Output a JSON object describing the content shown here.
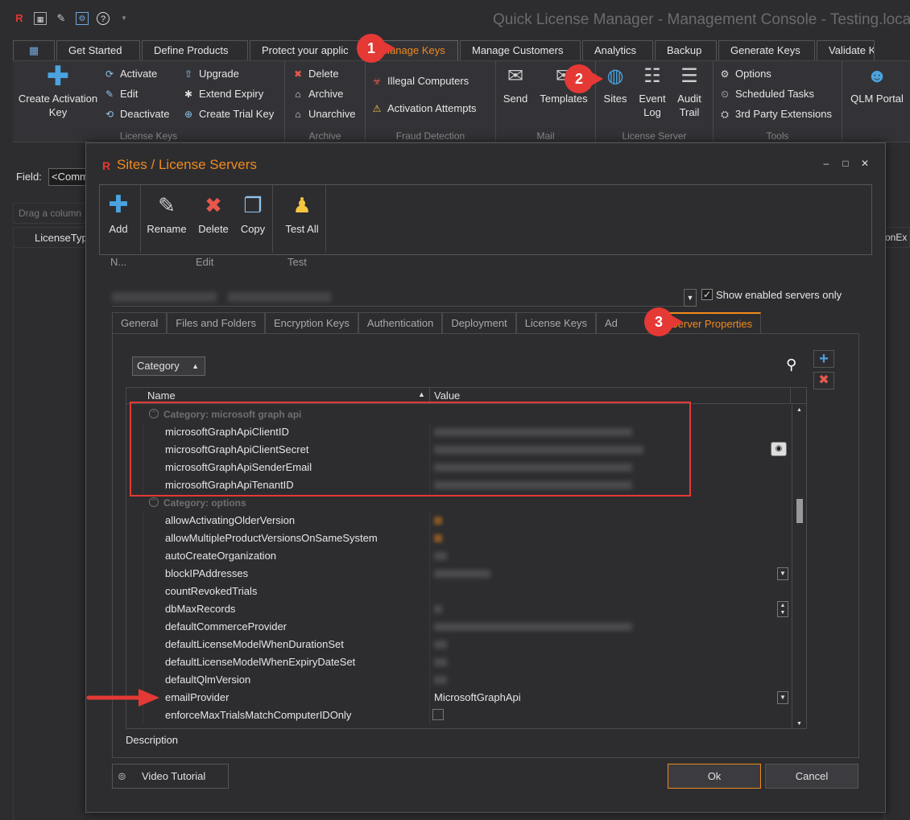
{
  "window": {
    "title": "Quick License Manager - Management Console - Testing.localh"
  },
  "quick_access": [
    "app-icon",
    "grid-icon",
    "wand-icon",
    "settings-icon",
    "help-icon",
    "dropdown-icon"
  ],
  "ribbon_tabs": [
    {
      "label": "Get Started"
    },
    {
      "label": "Define Products"
    },
    {
      "label": "Protect your applic"
    },
    {
      "label": "Manage Keys"
    },
    {
      "label": "Manage Customers"
    },
    {
      "label": "Analytics"
    },
    {
      "label": "Backup"
    },
    {
      "label": "Generate Keys"
    },
    {
      "label": "Validate K"
    }
  ],
  "ribbon": {
    "create_key": "Create Activation Key",
    "activate": "Activate",
    "edit": "Edit",
    "deactivate": "Deactivate",
    "upgrade": "Upgrade",
    "extend_expiry": "Extend Expiry",
    "create_trial_key": "Create Trial Key",
    "license_keys_group": "License Keys",
    "delete": "Delete",
    "archive": "Archive",
    "unarchive": "Unarchive",
    "archive_group": "Archive",
    "illegal_computers": "Illegal Computers",
    "activation_attempts": "Activation Attempts",
    "fraud_group": "Fraud Detection",
    "send": "Send",
    "templates": "Templates",
    "mail_group": "Mail",
    "sites": "Sites",
    "event_log": "Event Log",
    "audit_trail": "Audit Trail",
    "license_server_group": "License Server",
    "options": "Options",
    "scheduled_tasks": "Scheduled Tasks",
    "third_party": "3rd Party Extensions",
    "tools_group": "Tools",
    "qlm_portal": "QLM Portal"
  },
  "background": {
    "field_label": "Field:",
    "field_value": "<Comm",
    "drag_hint": "Drag a column",
    "license_type_col": "LicenseTyp",
    "right_col": "onEx"
  },
  "dialog": {
    "title": "Sites / License Servers",
    "toolbar": {
      "add": "Add",
      "rename": "Rename",
      "delete": "Delete",
      "copy": "Copy",
      "test_all": "Test All",
      "group_new": "N...",
      "group_edit": "Edit",
      "group_test": "Test"
    },
    "show_enabled_label": "Show enabled servers only",
    "show_enabled_checked": true,
    "tabs": [
      {
        "label": "General"
      },
      {
        "label": "Files and Folders"
      },
      {
        "label": "Encryption Keys"
      },
      {
        "label": "Authentication"
      },
      {
        "label": "Deployment"
      },
      {
        "label": "License Keys"
      },
      {
        "label": "Ad"
      },
      {
        "label": "Server Properties"
      }
    ],
    "category_button": "Category",
    "grid": {
      "col_name": "Name",
      "col_value": "Value",
      "rows": [
        {
          "type": "category",
          "name": "Category: microsoft graph api"
        },
        {
          "type": "prop",
          "name": "microsoftGraphApiClientID",
          "value": "",
          "value_kind": "blur"
        },
        {
          "type": "prop",
          "name": "microsoftGraphApiClientSecret",
          "value": "",
          "value_kind": "blur-eye"
        },
        {
          "type": "prop",
          "name": "microsoftGraphApiSenderEmail",
          "value": "",
          "value_kind": "blur"
        },
        {
          "type": "prop",
          "name": "microsoftGraphApiTenantID",
          "value": "",
          "value_kind": "blur"
        },
        {
          "type": "category",
          "name": "Category: options"
        },
        {
          "type": "prop",
          "name": "allowActivatingOlderVersion",
          "value": "",
          "value_kind": "orange"
        },
        {
          "type": "prop",
          "name": "allowMultipleProductVersionsOnSameSystem",
          "value": "",
          "value_kind": "orange"
        },
        {
          "type": "prop",
          "name": "autoCreateOrganization",
          "value": "",
          "value_kind": "blur-short"
        },
        {
          "type": "prop",
          "name": "blockIPAddresses",
          "value": "",
          "value_kind": "blur-dd"
        },
        {
          "type": "prop",
          "name": "countRevokedTrials",
          "value": "",
          "value_kind": "none"
        },
        {
          "type": "prop",
          "name": "dbMaxRecords",
          "value": "",
          "value_kind": "blur-spin"
        },
        {
          "type": "prop",
          "name": "defaultCommerceProvider",
          "value": "",
          "value_kind": "blur"
        },
        {
          "type": "prop",
          "name": "defaultLicenseModelWhenDurationSet",
          "value": "",
          "value_kind": "blur-short"
        },
        {
          "type": "prop",
          "name": "defaultLicenseModelWhenExpiryDateSet",
          "value": "",
          "value_kind": "blur-short"
        },
        {
          "type": "prop",
          "name": "defaultQlmVersion",
          "value": "",
          "value_kind": "blur-short"
        },
        {
          "type": "prop",
          "name": "emailProvider",
          "value": "MicrosoftGraphApi",
          "value_kind": "text-dd"
        },
        {
          "type": "prop",
          "name": "enforceMaxTrialsMatchComputerIDOnly",
          "value": "",
          "value_kind": "checkbox"
        }
      ]
    },
    "description_label": "Description",
    "video_tutorial": "Video Tutorial",
    "ok": "Ok",
    "cancel": "Cancel"
  },
  "annotations": [
    "1",
    "2",
    "3"
  ],
  "colors": {
    "accent": "#f08a1c",
    "annotation": "#e53935",
    "background": "#2d2d30"
  }
}
